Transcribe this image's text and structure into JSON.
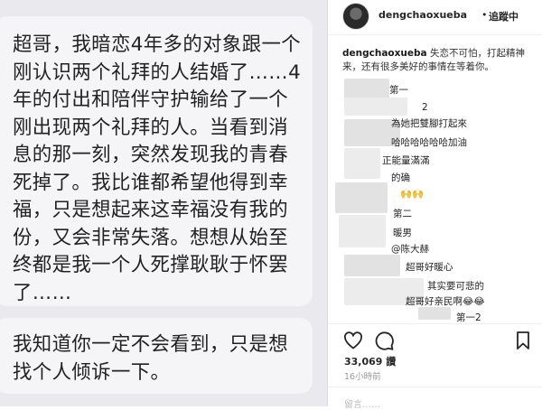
{
  "chat": {
    "message1": "超哥，我暗恋4年多的对象跟一个刚认识两个礼拜的人结婚了……4年的付出和陪伴守护输给了一个刚出现两个礼拜的人。当看到消息的那一刻，突然发现我的青春死掉了。我比谁都希望他得到幸福，只是想起来这幸福没有我的份，又会非常失落。想想从始至终都是我一个人死撑耿耿于怀罢了……",
    "message2": "我知道你一定不会看到，只是想找个人倾诉一下。"
  },
  "post": {
    "header": {
      "username": "dengchaoxueba",
      "separator": "•",
      "follow_label": "追蹤中"
    },
    "caption": {
      "username": "dengchaoxueba",
      "text": "失恋不可怕，打起精神来，还有很多美好的事情在等着你。"
    },
    "comments": [
      {
        "text": "第一"
      },
      {
        "text": "2"
      },
      {
        "text": "為她把雙腳打起來"
      },
      {
        "text": "哈哈哈哈哈哈加油"
      },
      {
        "text": "正能量滿滿"
      },
      {
        "text": "的确"
      },
      {
        "text": "🙌🙌"
      },
      {
        "text": "第二"
      },
      {
        "text": "暖男"
      },
      {
        "text": "@陈大赫"
      },
      {
        "text": "超哥好暖心"
      },
      {
        "text": "其实要可悲的"
      },
      {
        "text": "超哥好亲民啊😂😂"
      },
      {
        "text": "第一2"
      }
    ],
    "actions": {
      "like_icon": "heart-icon",
      "comment_icon": "comment-icon",
      "save_icon": "bookmark-icon"
    },
    "likes": "33,069 讚",
    "time_ago": "16小時前",
    "add_comment_placeholder": "留言……"
  },
  "colors": {
    "chat_background": "#e9e9ee",
    "bubble": "#f5f5f7",
    "text": "#262626",
    "muted": "#999999"
  }
}
